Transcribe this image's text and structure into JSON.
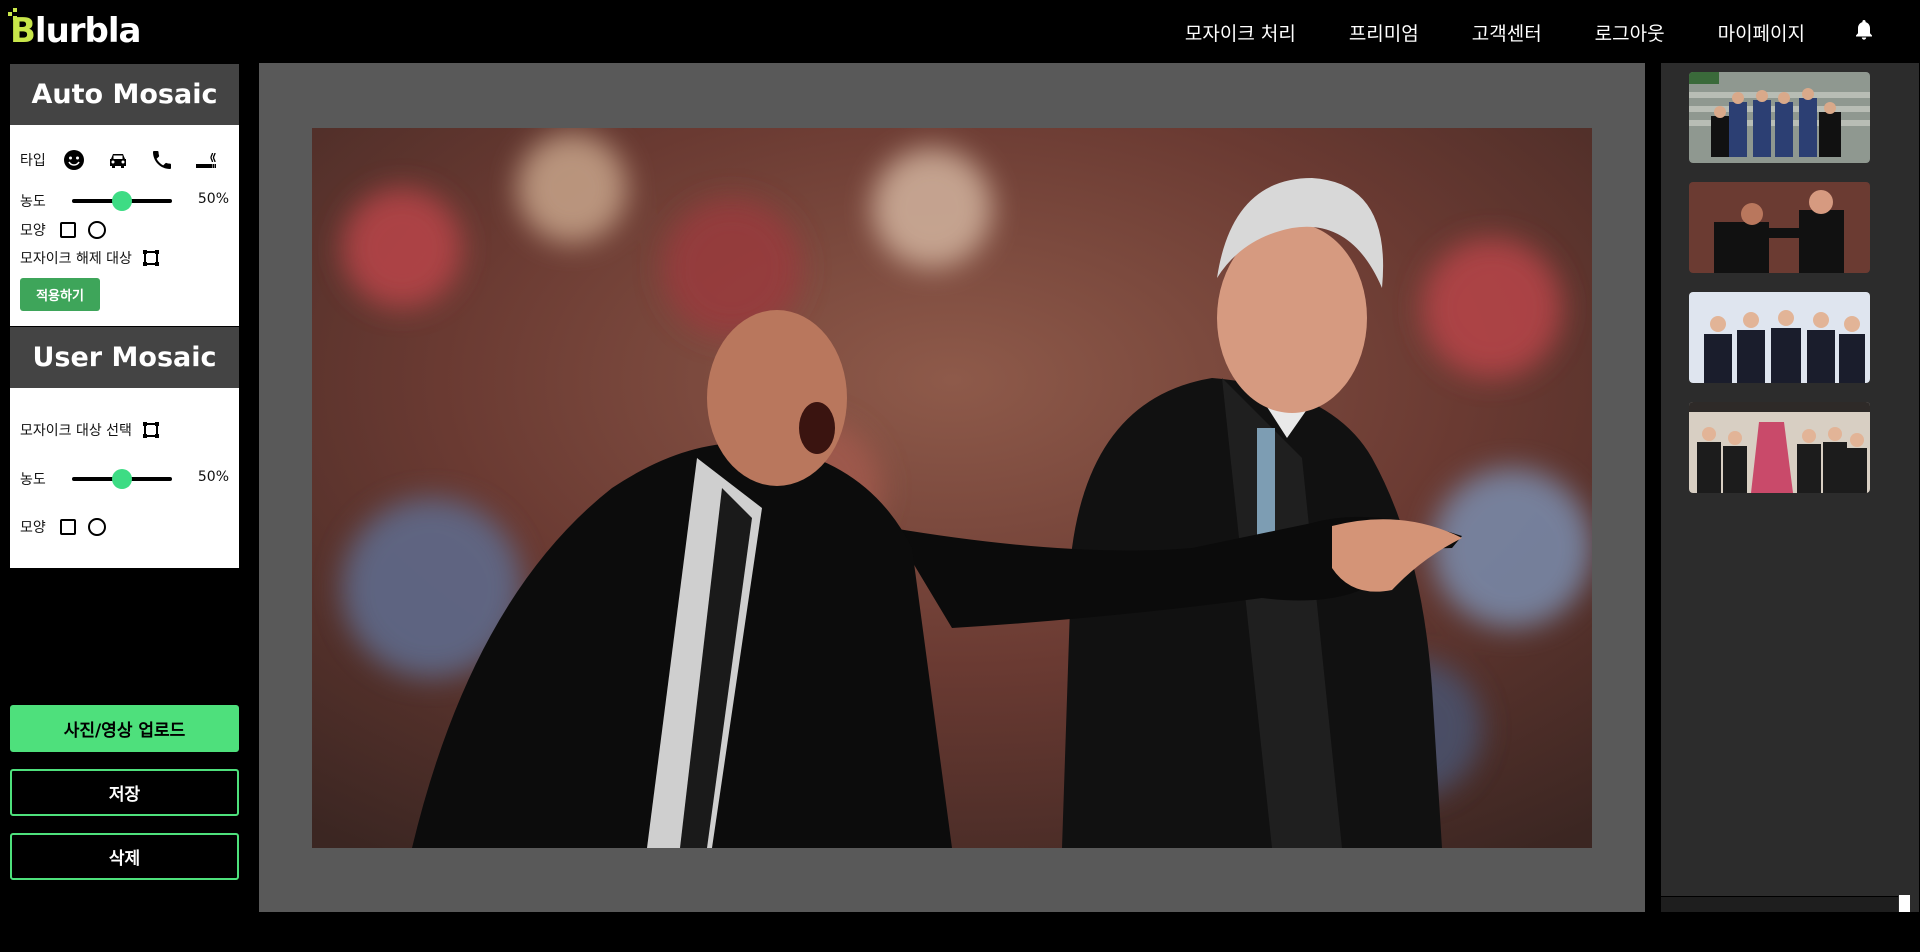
{
  "app": {
    "logo_text": "Blurbla"
  },
  "nav": {
    "items": [
      "모자이크 처리",
      "프리미엄",
      "고객센터",
      "로그아웃",
      "마이페이지"
    ],
    "bell_icon": "bell-icon"
  },
  "auto_mosaic": {
    "title": "Auto Mosaic",
    "type_label": "타입",
    "type_icons": [
      "face-icon",
      "car-icon",
      "phone-icon",
      "cigarette-icon"
    ],
    "density_label": "농도",
    "density_value": 0.5,
    "density_text": "50%",
    "shape_label": "모양",
    "exclude_label": "모자이크 해제 대상",
    "apply_button": "적용하기"
  },
  "user_mosaic": {
    "title": "User Mosaic",
    "target_label": "모자이크 대상 선택",
    "density_label": "농도",
    "density_value": 0.5,
    "density_text": "50%",
    "shape_label": "모양"
  },
  "actions": {
    "upload": "사진/영상 업로드",
    "save": "저장",
    "delete": "삭제"
  },
  "colors": {
    "accent": "#4ee07c",
    "apply": "#3ea55a",
    "panel_header": "#444444",
    "canvas_bg": "#595959"
  },
  "thumbnails": [
    "thumbnail-group-stairs",
    "thumbnail-two-coaches",
    "thumbnail-group-suits",
    "thumbnail-group-event"
  ]
}
